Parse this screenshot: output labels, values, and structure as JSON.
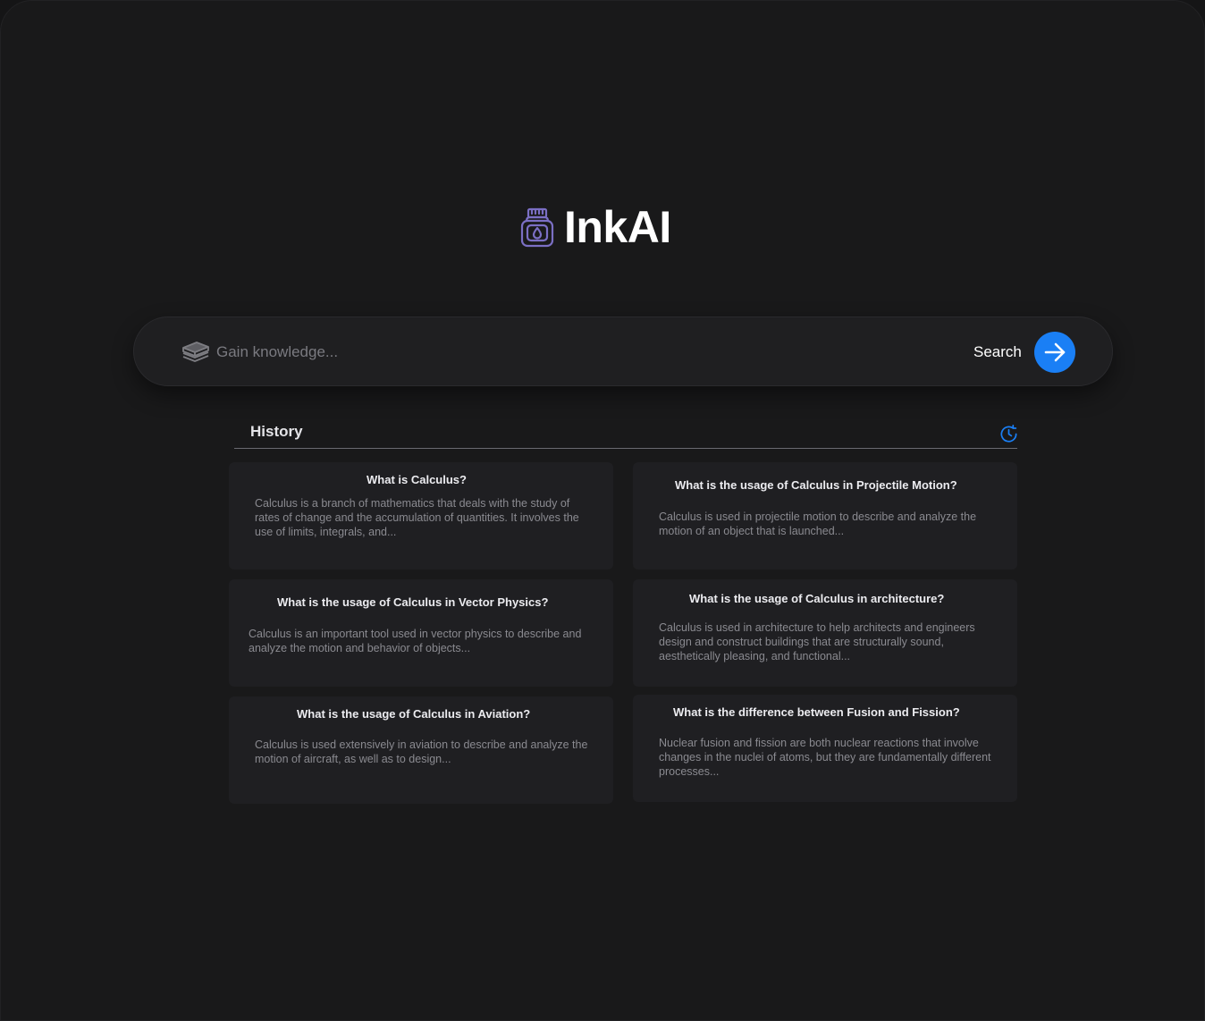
{
  "brand": {
    "name": "InkAI",
    "icon": "ink-bottle-icon",
    "icon_color": "#7b6fc4"
  },
  "search": {
    "placeholder": "Gain knowledge...",
    "icon": "books-stack-icon",
    "button_label": "Search",
    "button_icon": "arrow-right-icon",
    "accent_color": "#1a7ff5"
  },
  "history": {
    "title": "History",
    "icon": "history-clock-icon",
    "items": [
      {
        "title": "What is Calculus?",
        "summary": "Calculus is a branch of mathematics that deals with the study of rates of change and the accumulation of quantities. It involves the use of limits, integrals, and..."
      },
      {
        "title": "What is the usage of Calculus in Projectile Motion?",
        "summary": "Calculus is used in projectile motion to describe and analyze the motion of an object that is launched..."
      },
      {
        "title": "What is the usage of Calculus in Vector Physics?",
        "summary": "Calculus is an important tool used in vector physics to describe and analyze the motion and behavior of objects..."
      },
      {
        "title": "What is the usage of Calculus in architecture?",
        "summary": "Calculus is used in architecture to help architects and engineers design and construct buildings that are structurally sound, aesthetically pleasing, and functional..."
      },
      {
        "title": "What is the usage of Calculus in Aviation?",
        "summary": "Calculus is used extensively in aviation to describe and analyze the motion of aircraft, as well as to design..."
      },
      {
        "title": "What is the difference between Fusion and Fission?",
        "summary": "Nuclear fusion and fission are both nuclear reactions that involve changes in the nuclei of atoms, but they are fundamentally different processes..."
      }
    ]
  }
}
